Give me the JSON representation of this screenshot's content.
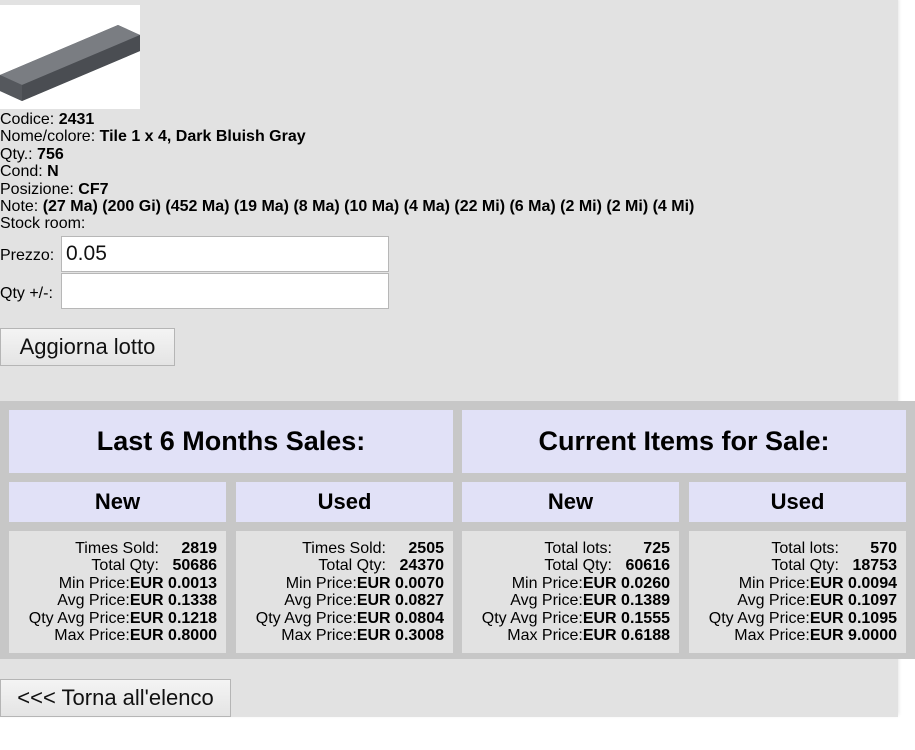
{
  "item": {
    "fields": [
      {
        "label": "Codice:",
        "value": "2431"
      },
      {
        "label": "Nome/colore:",
        "value": "Tile 1 x 4, Dark Bluish Gray"
      },
      {
        "label": "Qty.:",
        "value": "756"
      },
      {
        "label": "Cond:",
        "value": "N"
      },
      {
        "label": "Posizione:",
        "value": "CF7"
      },
      {
        "label": "Note:",
        "value": "(27 Ma) (200 Gi) (452 Ma) (19 Ma) (8 Ma) (10 Ma) (4 Ma) (22 Mi) (6 Ma) (2 Mi) (2 Mi) (4 Mi)"
      },
      {
        "label": "Stock room:",
        "value": ""
      }
    ],
    "image_color": "#5d6065"
  },
  "form": {
    "price_label": "Prezzo:",
    "price_value": "0.05",
    "qty_label": "Qty +/-:",
    "qty_value": "",
    "update_button": "Aggiorna lotto"
  },
  "stats": {
    "headers": {
      "last6": "Last 6 Months Sales:",
      "current": "Current Items for Sale:"
    },
    "sub": {
      "new": "New",
      "used": "Used"
    },
    "columns": [
      {
        "rows": [
          {
            "k": "Times Sold:",
            "v": "2819"
          },
          {
            "k": "Total Qty:",
            "v": "50686"
          },
          {
            "k": "Min Price:",
            "v": "EUR 0.0013"
          },
          {
            "k": "Avg Price:",
            "v": "EUR 0.1338"
          },
          {
            "k": "Qty Avg Price:",
            "v": "EUR 0.1218"
          },
          {
            "k": "Max Price:",
            "v": "EUR 0.8000"
          }
        ]
      },
      {
        "rows": [
          {
            "k": "Times Sold:",
            "v": "2505"
          },
          {
            "k": "Total Qty:",
            "v": "24370"
          },
          {
            "k": "Min Price:",
            "v": "EUR 0.0070"
          },
          {
            "k": "Avg Price:",
            "v": "EUR 0.0827"
          },
          {
            "k": "Qty Avg Price:",
            "v": "EUR 0.0804"
          },
          {
            "k": "Max Price:",
            "v": "EUR 0.3008"
          }
        ]
      },
      {
        "rows": [
          {
            "k": "Total lots:",
            "v": "725"
          },
          {
            "k": "Total Qty:",
            "v": "60616"
          },
          {
            "k": "Min Price:",
            "v": "EUR 0.0260"
          },
          {
            "k": "Avg Price:",
            "v": "EUR 0.1389"
          },
          {
            "k": "Qty Avg Price:",
            "v": "EUR 0.1555"
          },
          {
            "k": "Max Price:",
            "v": "EUR 0.6188"
          }
        ]
      },
      {
        "rows": [
          {
            "k": "Total lots:",
            "v": "570"
          },
          {
            "k": "Total Qty:",
            "v": "18753"
          },
          {
            "k": "Min Price:",
            "v": "EUR 0.0094"
          },
          {
            "k": "Avg Price:",
            "v": "EUR 0.1097"
          },
          {
            "k": "Qty Avg Price:",
            "v": "EUR 0.1095"
          },
          {
            "k": "Max Price:",
            "v": "EUR 9.0000"
          }
        ]
      }
    ]
  },
  "back_button": "<<< Torna all'elenco"
}
